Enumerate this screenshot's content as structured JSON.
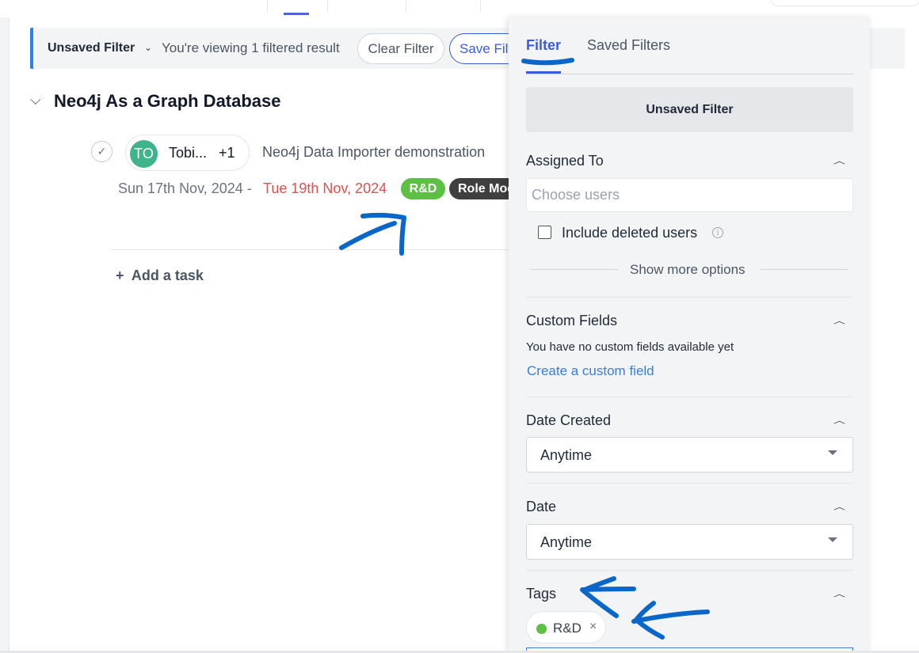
{
  "filter_bar": {
    "title": "Unsaved Filter",
    "info": "You're viewing 1 filtered result",
    "clear_label": "Clear Filter",
    "save_label": "Save Filter"
  },
  "group": {
    "title": "Neo4j As a Graph Database"
  },
  "task": {
    "assignee_initials": "TO",
    "assignee_name": "Tobi...",
    "assignee_more": "+1",
    "title": "Neo4j Data Importer demonstration",
    "start_date": "Sun 17th Nov, 2024 -",
    "end_date": "Tue 19th Nov, 2024",
    "tags": [
      "R&D",
      "Role Mod"
    ]
  },
  "add_task_label": "Add a task",
  "panel": {
    "tabs": [
      "Filter",
      "Saved Filters"
    ],
    "saved_filter_name": "Unsaved Filter",
    "assigned_to": {
      "title": "Assigned To",
      "placeholder": "Choose users",
      "include_deleted_label": "Include deleted users",
      "show_more_label": "Show more options"
    },
    "custom_fields": {
      "title": "Custom Fields",
      "note": "You have no custom fields available yet",
      "link": "Create a custom field"
    },
    "date_created": {
      "title": "Date Created",
      "value": "Anytime"
    },
    "date": {
      "title": "Date",
      "value": "Anytime"
    },
    "tags": {
      "title": "Tags",
      "selected": "R&D",
      "remove_symbol": "×"
    }
  },
  "colors": {
    "accent": "#3b5bdb",
    "filter_bar_border": "#2f80ed",
    "tag_green": "#5cc142",
    "overdue_red": "#d9534f",
    "annotation_blue": "#0a66c9"
  }
}
